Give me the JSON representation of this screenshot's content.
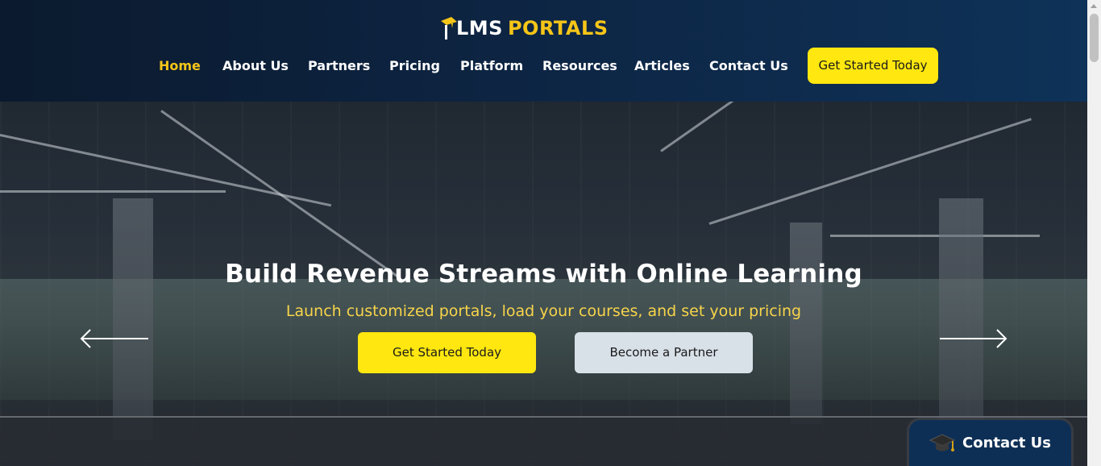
{
  "logo": {
    "text_lms": "LMS",
    "text_portals": "PORTALS"
  },
  "nav": {
    "items": [
      {
        "label": "Home",
        "active": true
      },
      {
        "label": "About Us",
        "active": false
      },
      {
        "label": "Partners",
        "active": false
      },
      {
        "label": "Pricing",
        "active": false
      },
      {
        "label": "Platform",
        "active": false
      },
      {
        "label": "Resources",
        "active": false
      },
      {
        "label": "Articles",
        "active": false
      },
      {
        "label": "Contact Us",
        "active": false
      }
    ],
    "cta_label": "Get Started Today"
  },
  "hero": {
    "title": "Build Revenue Streams with Online Learning",
    "subtitle": "Launch customized portals, load your courses, and set your pricing",
    "primary_button": "Get Started Today",
    "secondary_button": "Become a Partner",
    "prev_icon": "arrow-left-icon",
    "next_icon": "arrow-right-icon"
  },
  "contact_widget": {
    "label": "Contact Us",
    "icon": "graduation-cap-icon"
  },
  "colors": {
    "accent_yellow": "#ffe70f",
    "active_nav": "#f5c518",
    "header_dark": "#0b1a2e",
    "secondary_button": "#d8e0e8"
  }
}
